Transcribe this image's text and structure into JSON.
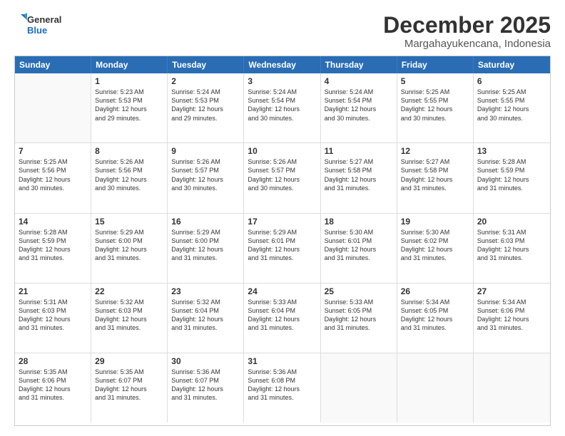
{
  "logo": {
    "line1": "General",
    "line2": "Blue"
  },
  "title": "December 2025",
  "location": "Margahayukencana, Indonesia",
  "days_of_week": [
    "Sunday",
    "Monday",
    "Tuesday",
    "Wednesday",
    "Thursday",
    "Friday",
    "Saturday"
  ],
  "weeks": [
    [
      {
        "day": "",
        "info": ""
      },
      {
        "day": "1",
        "info": "Sunrise: 5:23 AM\nSunset: 5:53 PM\nDaylight: 12 hours\nand 29 minutes."
      },
      {
        "day": "2",
        "info": "Sunrise: 5:24 AM\nSunset: 5:53 PM\nDaylight: 12 hours\nand 29 minutes."
      },
      {
        "day": "3",
        "info": "Sunrise: 5:24 AM\nSunset: 5:54 PM\nDaylight: 12 hours\nand 30 minutes."
      },
      {
        "day": "4",
        "info": "Sunrise: 5:24 AM\nSunset: 5:54 PM\nDaylight: 12 hours\nand 30 minutes."
      },
      {
        "day": "5",
        "info": "Sunrise: 5:25 AM\nSunset: 5:55 PM\nDaylight: 12 hours\nand 30 minutes."
      },
      {
        "day": "6",
        "info": "Sunrise: 5:25 AM\nSunset: 5:55 PM\nDaylight: 12 hours\nand 30 minutes."
      }
    ],
    [
      {
        "day": "7",
        "info": "Sunrise: 5:25 AM\nSunset: 5:56 PM\nDaylight: 12 hours\nand 30 minutes."
      },
      {
        "day": "8",
        "info": "Sunrise: 5:26 AM\nSunset: 5:56 PM\nDaylight: 12 hours\nand 30 minutes."
      },
      {
        "day": "9",
        "info": "Sunrise: 5:26 AM\nSunset: 5:57 PM\nDaylight: 12 hours\nand 30 minutes."
      },
      {
        "day": "10",
        "info": "Sunrise: 5:26 AM\nSunset: 5:57 PM\nDaylight: 12 hours\nand 30 minutes."
      },
      {
        "day": "11",
        "info": "Sunrise: 5:27 AM\nSunset: 5:58 PM\nDaylight: 12 hours\nand 31 minutes."
      },
      {
        "day": "12",
        "info": "Sunrise: 5:27 AM\nSunset: 5:58 PM\nDaylight: 12 hours\nand 31 minutes."
      },
      {
        "day": "13",
        "info": "Sunrise: 5:28 AM\nSunset: 5:59 PM\nDaylight: 12 hours\nand 31 minutes."
      }
    ],
    [
      {
        "day": "14",
        "info": "Sunrise: 5:28 AM\nSunset: 5:59 PM\nDaylight: 12 hours\nand 31 minutes."
      },
      {
        "day": "15",
        "info": "Sunrise: 5:29 AM\nSunset: 6:00 PM\nDaylight: 12 hours\nand 31 minutes."
      },
      {
        "day": "16",
        "info": "Sunrise: 5:29 AM\nSunset: 6:00 PM\nDaylight: 12 hours\nand 31 minutes."
      },
      {
        "day": "17",
        "info": "Sunrise: 5:29 AM\nSunset: 6:01 PM\nDaylight: 12 hours\nand 31 minutes."
      },
      {
        "day": "18",
        "info": "Sunrise: 5:30 AM\nSunset: 6:01 PM\nDaylight: 12 hours\nand 31 minutes."
      },
      {
        "day": "19",
        "info": "Sunrise: 5:30 AM\nSunset: 6:02 PM\nDaylight: 12 hours\nand 31 minutes."
      },
      {
        "day": "20",
        "info": "Sunrise: 5:31 AM\nSunset: 6:03 PM\nDaylight: 12 hours\nand 31 minutes."
      }
    ],
    [
      {
        "day": "21",
        "info": "Sunrise: 5:31 AM\nSunset: 6:03 PM\nDaylight: 12 hours\nand 31 minutes."
      },
      {
        "day": "22",
        "info": "Sunrise: 5:32 AM\nSunset: 6:03 PM\nDaylight: 12 hours\nand 31 minutes."
      },
      {
        "day": "23",
        "info": "Sunrise: 5:32 AM\nSunset: 6:04 PM\nDaylight: 12 hours\nand 31 minutes."
      },
      {
        "day": "24",
        "info": "Sunrise: 5:33 AM\nSunset: 6:04 PM\nDaylight: 12 hours\nand 31 minutes."
      },
      {
        "day": "25",
        "info": "Sunrise: 5:33 AM\nSunset: 6:05 PM\nDaylight: 12 hours\nand 31 minutes."
      },
      {
        "day": "26",
        "info": "Sunrise: 5:34 AM\nSunset: 6:05 PM\nDaylight: 12 hours\nand 31 minutes."
      },
      {
        "day": "27",
        "info": "Sunrise: 5:34 AM\nSunset: 6:06 PM\nDaylight: 12 hours\nand 31 minutes."
      }
    ],
    [
      {
        "day": "28",
        "info": "Sunrise: 5:35 AM\nSunset: 6:06 PM\nDaylight: 12 hours\nand 31 minutes."
      },
      {
        "day": "29",
        "info": "Sunrise: 5:35 AM\nSunset: 6:07 PM\nDaylight: 12 hours\nand 31 minutes."
      },
      {
        "day": "30",
        "info": "Sunrise: 5:36 AM\nSunset: 6:07 PM\nDaylight: 12 hours\nand 31 minutes."
      },
      {
        "day": "31",
        "info": "Sunrise: 5:36 AM\nSunset: 6:08 PM\nDaylight: 12 hours\nand 31 minutes."
      },
      {
        "day": "",
        "info": ""
      },
      {
        "day": "",
        "info": ""
      },
      {
        "day": "",
        "info": ""
      }
    ]
  ]
}
